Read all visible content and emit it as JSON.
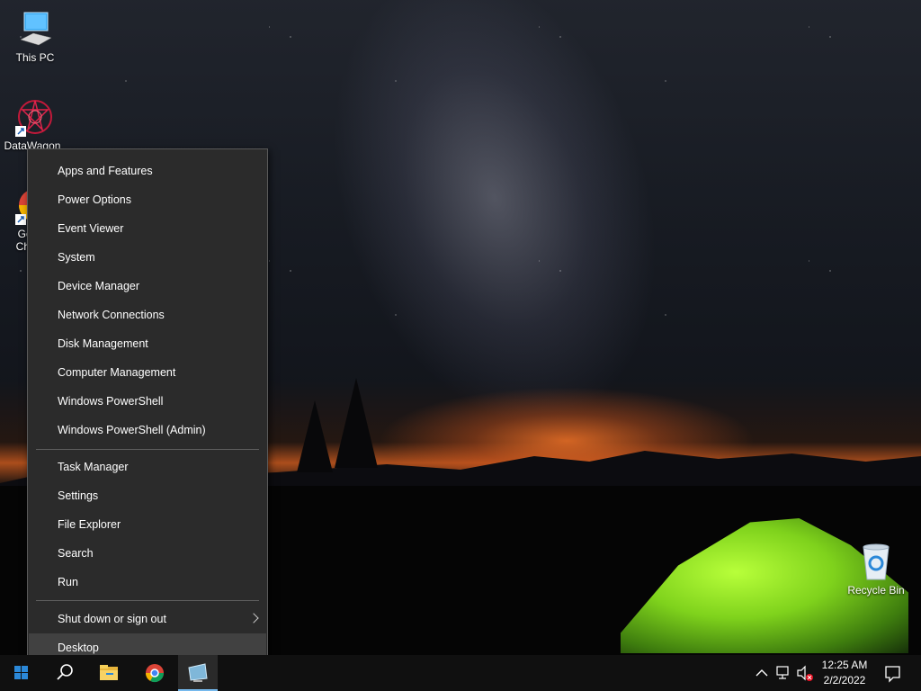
{
  "desktop": {
    "icons": [
      {
        "label": "This PC",
        "icon": "computer-icon"
      },
      {
        "label": "DataWagon",
        "icon": "datawagon-logo-icon"
      },
      {
        "label": "Google Chrome",
        "icon": "chrome-icon",
        "visible_label_fragment": "G\nCh"
      },
      {
        "label": "Recycle Bin",
        "icon": "recycle-bin-icon"
      }
    ]
  },
  "menu": {
    "group1": [
      "Apps and Features",
      "Power Options",
      "Event Viewer",
      "System",
      "Device Manager",
      "Network Connections",
      "Disk Management",
      "Computer Management",
      "Windows PowerShell",
      "Windows PowerShell (Admin)"
    ],
    "group2": [
      "Task Manager",
      "Settings",
      "File Explorer",
      "Search",
      "Run"
    ],
    "group3": [
      {
        "label": "Shut down or sign out",
        "has_submenu": true
      },
      {
        "label": "Desktop",
        "hovered": true
      }
    ]
  },
  "taskbar": {
    "time": "12:25 AM",
    "date": "2/2/2022",
    "pinned": [
      "start-icon",
      "search-icon",
      "file-explorer-icon",
      "chrome-icon",
      "app-icon"
    ],
    "tray": [
      "chevron-up-icon",
      "network-icon",
      "volume-muted-icon",
      "action-center-icon"
    ]
  },
  "colors": {
    "menu_bg": "#2b2b2b",
    "menu_hover": "#414141",
    "taskbar_bg": "#101010",
    "start_accent": "#2b88d8"
  }
}
